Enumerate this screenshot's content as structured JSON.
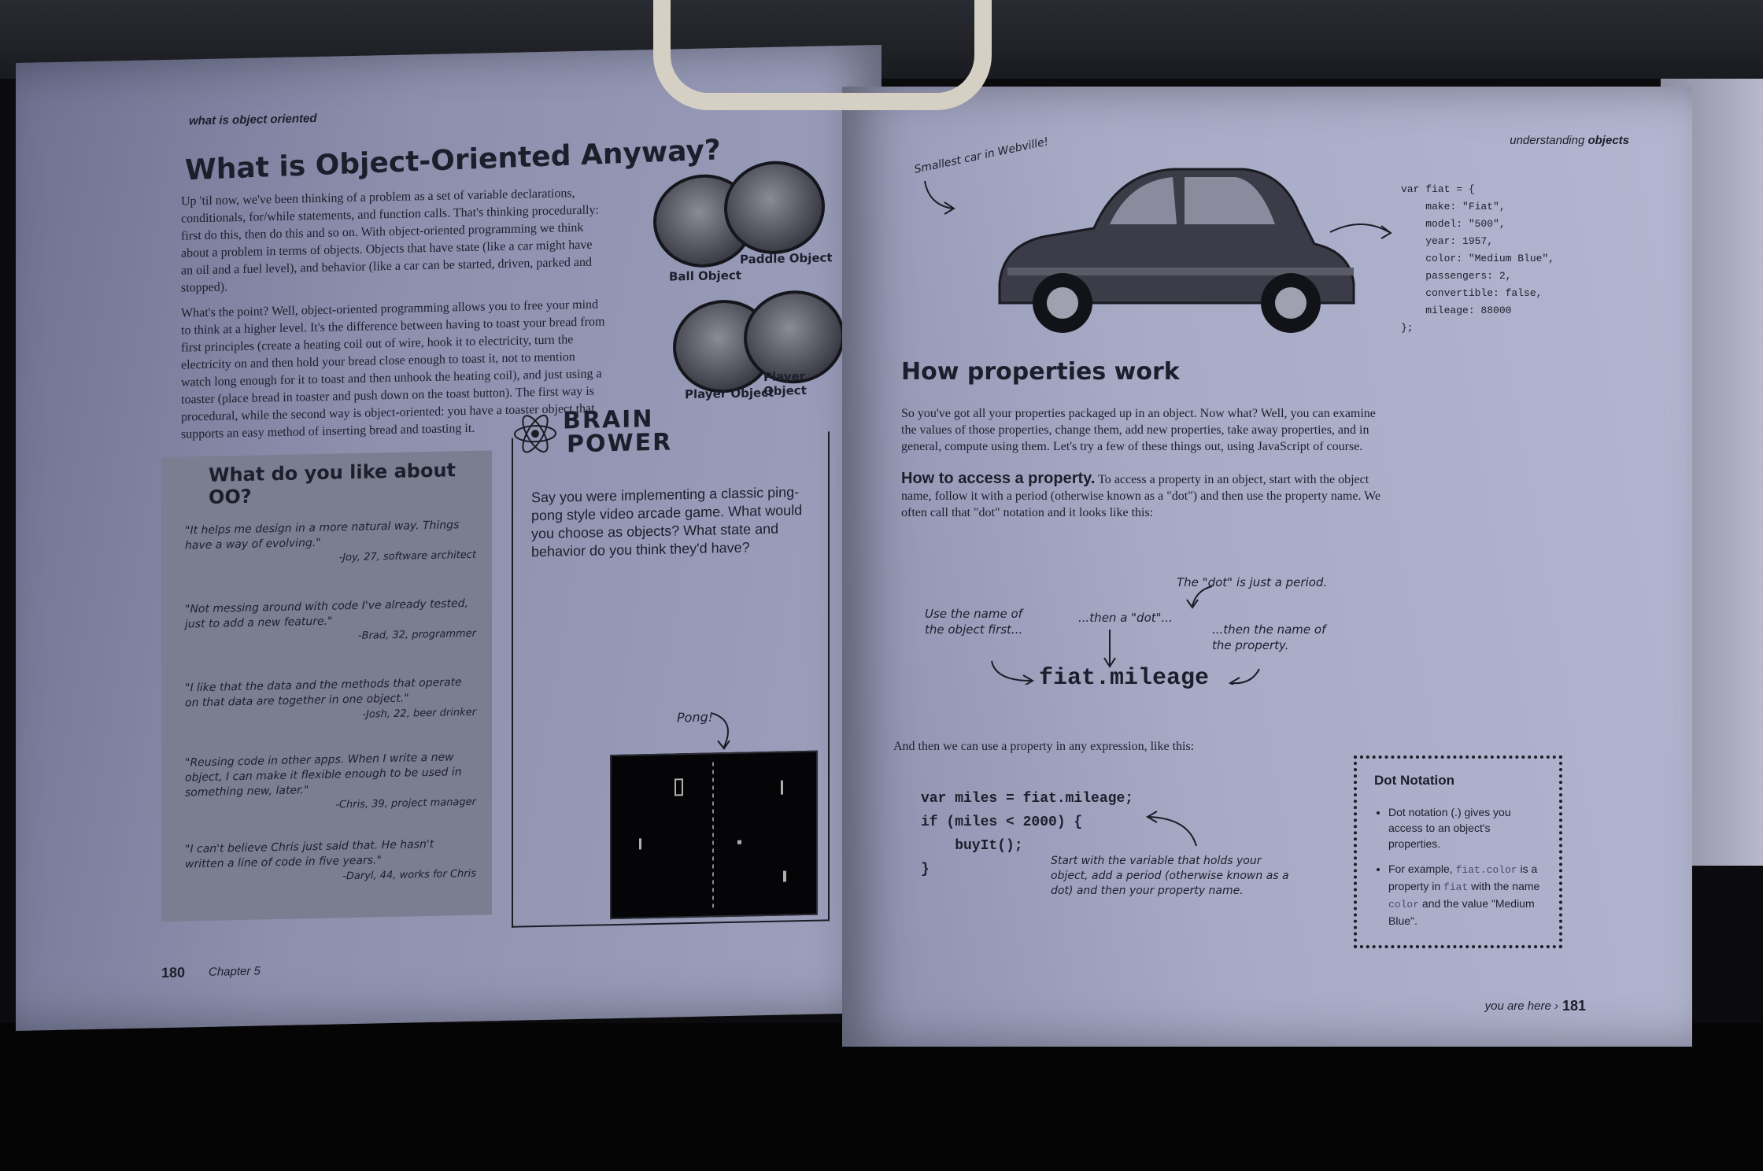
{
  "left_page": {
    "running_head": "what is object oriented",
    "title": "What is Object-Oriented Anyway?",
    "paragraphs": [
      "Up 'til now, we've been thinking of a problem as a set of variable declarations, conditionals, for/while statements, and function calls. That's thinking procedurally: first do this, then do this and so on. With object-oriented programming we think about a problem in terms of objects. Objects that have state (like a car might have an oil and a fuel level), and behavior (like a car can be started, driven, parked and stopped).",
      "What's the point? Well, object-oriented programming allows you to free your mind to think at a higher level. It's the difference between having to toast your bread from first principles (create a heating coil out of wire, hook it to electricity, turn the electricity on and then hold your bread close enough to toast it, not to mention watch long enough for it to toast and then unhook the heating coil), and just using a toaster (place bread in toaster and push down on the toast button). The first way is procedural, while the second way is object-oriented: you have a toaster object that supports an easy method of inserting bread and toasting it."
    ],
    "disc_labels": [
      "Ball Object",
      "Paddle Object",
      "Player Object",
      "Player Object"
    ],
    "quote_box": {
      "title": "What do you like about OO?",
      "quotes": [
        {
          "text": "\"It helps me design in a more natural way. Things have a way of evolving.\"",
          "who": "-Joy, 27, software architect"
        },
        {
          "text": "\"Not messing around with code I've already tested, just to add a new feature.\"",
          "who": "-Brad, 32, programmer"
        },
        {
          "text": "\"I like that the data and the methods that operate on that data are together in one object.\"",
          "who": "-Josh, 22, beer drinker"
        },
        {
          "text": "\"Reusing code in other apps. When I write a new object, I can make it flexible enough to be used in something new, later.\"",
          "who": "-Chris, 39, project manager"
        },
        {
          "text": "\"I can't believe Chris just said that. He hasn't written a line of code in five years.\"",
          "who": "-Daryl, 44, works for Chris"
        }
      ]
    },
    "brain_power": {
      "title_line1": "BRAIN",
      "title_line2": "POWER",
      "text": "Say you were implementing a classic ping-pong style video arcade game. What would you choose as objects? What state and behavior do you think they'd have?",
      "pong_label": "Pong!"
    },
    "page_number": "180",
    "chapter": "Chapter 5"
  },
  "right_page": {
    "running_head_light": "understanding",
    "running_head_bold": "objects",
    "car_caption": "Smallest car in Webville!",
    "code_object": "var fiat = {\n    make: \"Fiat\",\n    model: \"500\",\n    year: 1957,\n    color: \"Medium Blue\",\n    passengers: 2,\n    convertible: false,\n    mileage: 88000\n};",
    "title": "How properties work",
    "intro": "So you've got all your properties packaged up in an object. Now what? Well, you can examine the values of those properties, change them, add new properties, take away properties, and in general, compute using them. Let's try a few of these things out, using JavaScript of course.",
    "access_heading": "How to access a property.",
    "access_text": "To access a property in an object, start with the object name, follow it with a period (otherwise known as a \"dot\") and then use the property name. We often call that \"dot\" notation and it looks like this:",
    "annotations": {
      "dot_period": "The \"dot\" is just a period.",
      "object_first": "Use the name of the object first...",
      "then_dot": "...then a \"dot\"...",
      "then_property": "...then the name of the property."
    },
    "dot_expression": "fiat.mileage",
    "any_expression": "And then we can use a property in any expression, like this:",
    "code_example": "var miles = fiat.mileage;\nif (miles < 2000) {\n    buyIt();\n}",
    "code_annotation": "Start with the variable that holds your object, add a period (otherwise known as a dot) and then your property name.",
    "note_box": {
      "title": "Dot Notation",
      "item1": "Dot notation (.) gives you access to an object's properties.",
      "item2_pre": "For example, ",
      "item2_code1": "fiat.color",
      "item2_mid1": " is a property in ",
      "item2_code2": "fiat",
      "item2_mid2": " with the name ",
      "item2_code3": "color",
      "item2_post": " and the value \"Medium Blue\"."
    },
    "you_are_here": "you are here ›",
    "page_number": "181"
  },
  "colors": {
    "page_tint": "#a7aac5",
    "ink": "#1d1e2c",
    "quote_box_bg": "#7b7d91",
    "background": "#0b0b0d"
  }
}
